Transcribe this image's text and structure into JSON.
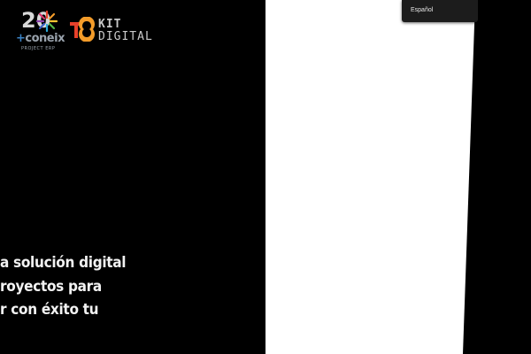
{
  "logos": {
    "coneix": {
      "numeral": "20",
      "name": "coneix",
      "subtitle": "PROJECT ERP"
    },
    "kit_digital": {
      "line1": "KIT",
      "line2": "DIGITAL"
    }
  },
  "language_menu": {
    "selected": "Español"
  },
  "hero": {
    "headline_lines": [
      "a solución digital",
      "royectos para",
      "r con éxito tu"
    ]
  },
  "colors": {
    "background": "#000000",
    "panel": "#ffffff",
    "kit_red": "#e8412b",
    "kit_orange": "#f39c2a",
    "coneix_blue": "#3b82c4"
  }
}
